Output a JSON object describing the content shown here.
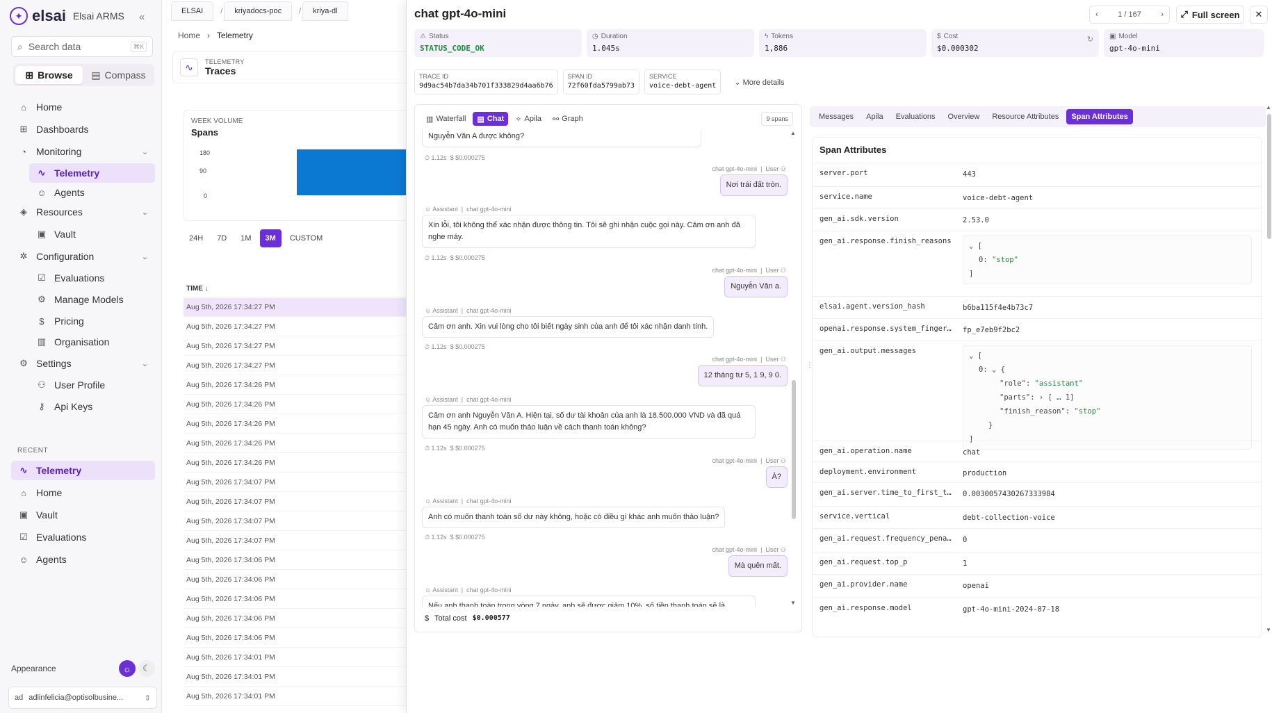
{
  "sidebar": {
    "brand": "elsai",
    "brand_sub": "Elsai ARMS",
    "search_placeholder": "Search data",
    "search_kbd": "⌘K",
    "toggle": {
      "browse": "Browse",
      "compass": "Compass"
    },
    "nav": {
      "home": "Home",
      "dashboards": "Dashboards",
      "monitoring": "Monitoring",
      "telemetry": "Telemetry",
      "agents": "Agents",
      "resources": "Resources",
      "vault": "Vault",
      "configuration": "Configuration",
      "evaluations": "Evaluations",
      "manage_models": "Manage Models",
      "pricing": "Pricing",
      "organisation": "Organisation",
      "settings": "Settings",
      "user_profile": "User Profile",
      "api_keys": "Api Keys"
    },
    "recent_label": "RECENT",
    "recent": [
      "Telemetry",
      "Home",
      "Vault",
      "Evaluations",
      "Agents"
    ],
    "appearance": "Appearance",
    "user_initials": "ad",
    "user_email": "adlinfelicia@optisolbusine..."
  },
  "main": {
    "tabs": [
      "ELSAI",
      "kriyadocs-poc",
      "kriya-dl"
    ],
    "breadcrumb": {
      "root": "Home",
      "current": "Telemetry"
    },
    "header_kicker": "TELEMETRY",
    "header_title": "Traces",
    "volume_kicker": "WEEK VOLUME",
    "volume_title": "Spans",
    "y_ticks": [
      "180",
      "90",
      "0"
    ],
    "ranges": [
      "24H",
      "7D",
      "1M",
      "3M",
      "CUSTOM"
    ],
    "time_header": "TIME ↓",
    "rows": [
      "Aug 5th, 2026 17:34:27 PM",
      "Aug 5th, 2026 17:34:27 PM",
      "Aug 5th, 2026 17:34:27 PM",
      "Aug 5th, 2026 17:34:27 PM",
      "Aug 5th, 2026 17:34:26 PM",
      "Aug 5th, 2026 17:34:26 PM",
      "Aug 5th, 2026 17:34:26 PM",
      "Aug 5th, 2026 17:34:26 PM",
      "Aug 5th, 2026 17:34:26 PM",
      "Aug 5th, 2026 17:34:07 PM",
      "Aug 5th, 2026 17:34:07 PM",
      "Aug 5th, 2026 17:34:07 PM",
      "Aug 5th, 2026 17:34:07 PM",
      "Aug 5th, 2026 17:34:06 PM",
      "Aug 5th, 2026 17:34:06 PM",
      "Aug 5th, 2026 17:34:06 PM",
      "Aug 5th, 2026 17:34:06 PM",
      "Aug 5th, 2026 17:34:06 PM",
      "Aug 5th, 2026 17:34:01 PM",
      "Aug 5th, 2026 17:34:01 PM",
      "Aug 5th, 2026 17:34:01 PM"
    ]
  },
  "drawer": {
    "title": "chat gpt-4o-mini",
    "pager": "1 / 167",
    "full_screen": "Full screen",
    "stats": {
      "status_k": "Status",
      "status_v": "STATUS_CODE_OK",
      "duration_k": "Duration",
      "duration_v": "1.045s",
      "tokens_k": "Tokens",
      "tokens_v": "1,886",
      "cost_k": "Cost",
      "cost_v": "$0.000302",
      "model_k": "Model",
      "model_v": "gpt-4o-mini"
    },
    "ids": {
      "trace_k": "TRACE ID",
      "trace_v": "9d9ac54b7da34b701f333829d4aa6b76",
      "span_k": "SPAN ID",
      "span_v": "72f60fda5799ab73",
      "service_k": "SERVICE",
      "service_v": "voice-debt-agent",
      "more": "More details"
    },
    "views": [
      "Waterfall",
      "Chat",
      "Apila",
      "Graph"
    ],
    "spans": "9 spans",
    "msg_meta_user": "chat gpt-4o-mini",
    "msg_user": "User",
    "msg_assistant": "Assistant",
    "msg_time": "1.12s",
    "msg_cost": "$ $0.000275",
    "messages": {
      "a0": "Nguyễn Văn A được không?",
      "u1": "Nơi trái đất tròn.",
      "a1": "Xin lỗi, tôi không thể xác nhận được thông tin. Tôi sẽ ghi nhận cuộc gọi này. Cảm ơn anh đã nghe máy.",
      "u2": "Nguyễn Văn a.",
      "a2": "Cảm ơn anh. Xin vui lòng cho tôi biết ngày sinh của anh để tôi xác nhận danh tính.",
      "u3": "12 tháng tư 5, 1 9, 9 0.",
      "a3": "Cảm ơn anh Nguyễn Văn A. Hiện tại, số dư tài khoản của anh là 18.500.000 VND và đã quá hạn 45 ngày. Anh có muốn thảo luận về cách thanh toán không?",
      "u4": "À?",
      "a4": "Anh có muốn thanh toán số dư này không, hoặc có điều gì khác anh muốn thảo luận?",
      "u5": "Mà quên mất.",
      "a5": "Nếu anh thanh toán trong vòng 7 ngày, anh sẽ được giảm 10%, số tiền thanh toán sẽ là"
    },
    "total_label": "Total cost",
    "total_value": "$0.000577",
    "attr_tabs": [
      "Messages",
      "Apila",
      "Evaluations",
      "Overview",
      "Resource Attributes",
      "Span Attributes"
    ],
    "attr_title": "Span Attributes",
    "attrs": {
      "server_port_k": "server.port",
      "server_port_v": "443",
      "service_name_k": "service.name",
      "service_name_v": "voice-debt-agent",
      "sdk_k": "gen_ai.sdk.version",
      "sdk_v": "2.53.0",
      "finish_k": "gen_ai.response.finish_reasons",
      "finish_idx": "0:",
      "finish_v": "\"stop\"",
      "hash_k": "elsai.agent.version_hash",
      "hash_v": "b6ba115f4e4b73c7",
      "fp_k": "openai.response.system_finger…",
      "fp_v": "fp_e7eb9f2bc2",
      "out_k": "gen_ai.output.messages",
      "role_k": "\"role\"",
      "role_v": "\"assistant\"",
      "parts_k": "\"parts\"",
      "parts_v": "[ … 1]",
      "fr_k": "\"finish_reason\"",
      "fr_v": "\"stop\"",
      "op_k": "gen_ai.operation.name",
      "op_v": "chat",
      "env_k": "deployment.environment",
      "env_v": "production",
      "ttft_k": "gen_ai.server.time_to_first_t…",
      "ttft_v": "0.0030057430267333984",
      "vert_k": "service.vertical",
      "vert_v": "debt-collection-voice",
      "freq_k": "gen_ai.request.frequency_pena…",
      "freq_v": "0",
      "topp_k": "gen_ai.request.top_p",
      "topp_v": "1",
      "prov_k": "gen_ai.provider.name",
      "prov_v": "openai",
      "model_k": "gen_ai.response.model",
      "model_v": "gpt-4o-mini-2024-07-18"
    }
  }
}
